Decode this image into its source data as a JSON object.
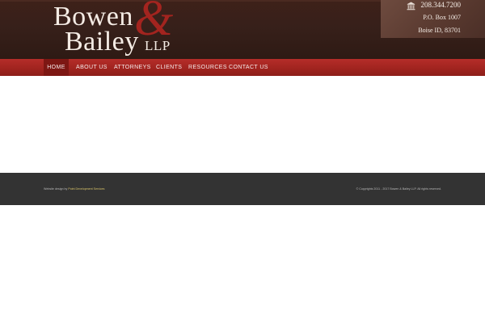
{
  "logo": {
    "word1": "Bowen",
    "ampersand": "&",
    "word2": "Bailey",
    "suffix": "LLP"
  },
  "contact": {
    "phone": "208.344.7200",
    "po_box": "P.O. Box 1007",
    "city": "Boise ID, 83701",
    "icon": "building-icon"
  },
  "nav": {
    "items": [
      {
        "label": "HOME",
        "active": true
      },
      {
        "label": "ABOUT US"
      },
      {
        "label": "ATTORNEYS"
      },
      {
        "label": "CLIENTS"
      },
      {
        "label": "RESOURCES"
      },
      {
        "label": "CONTACT US"
      }
    ]
  },
  "footer": {
    "credit_prefix": "Website design by",
    "credit_link": "Point Development Services",
    "copyright": "© Copyrights 2011 - 2017 Bowen & Bailey LLP. All rights reserved."
  },
  "colors": {
    "header_brown": "#37201a",
    "nav_red": "#a1241f",
    "nav_active": "#7d1713",
    "ampersand_red": "#a3241f",
    "footer_gray": "#333333"
  }
}
